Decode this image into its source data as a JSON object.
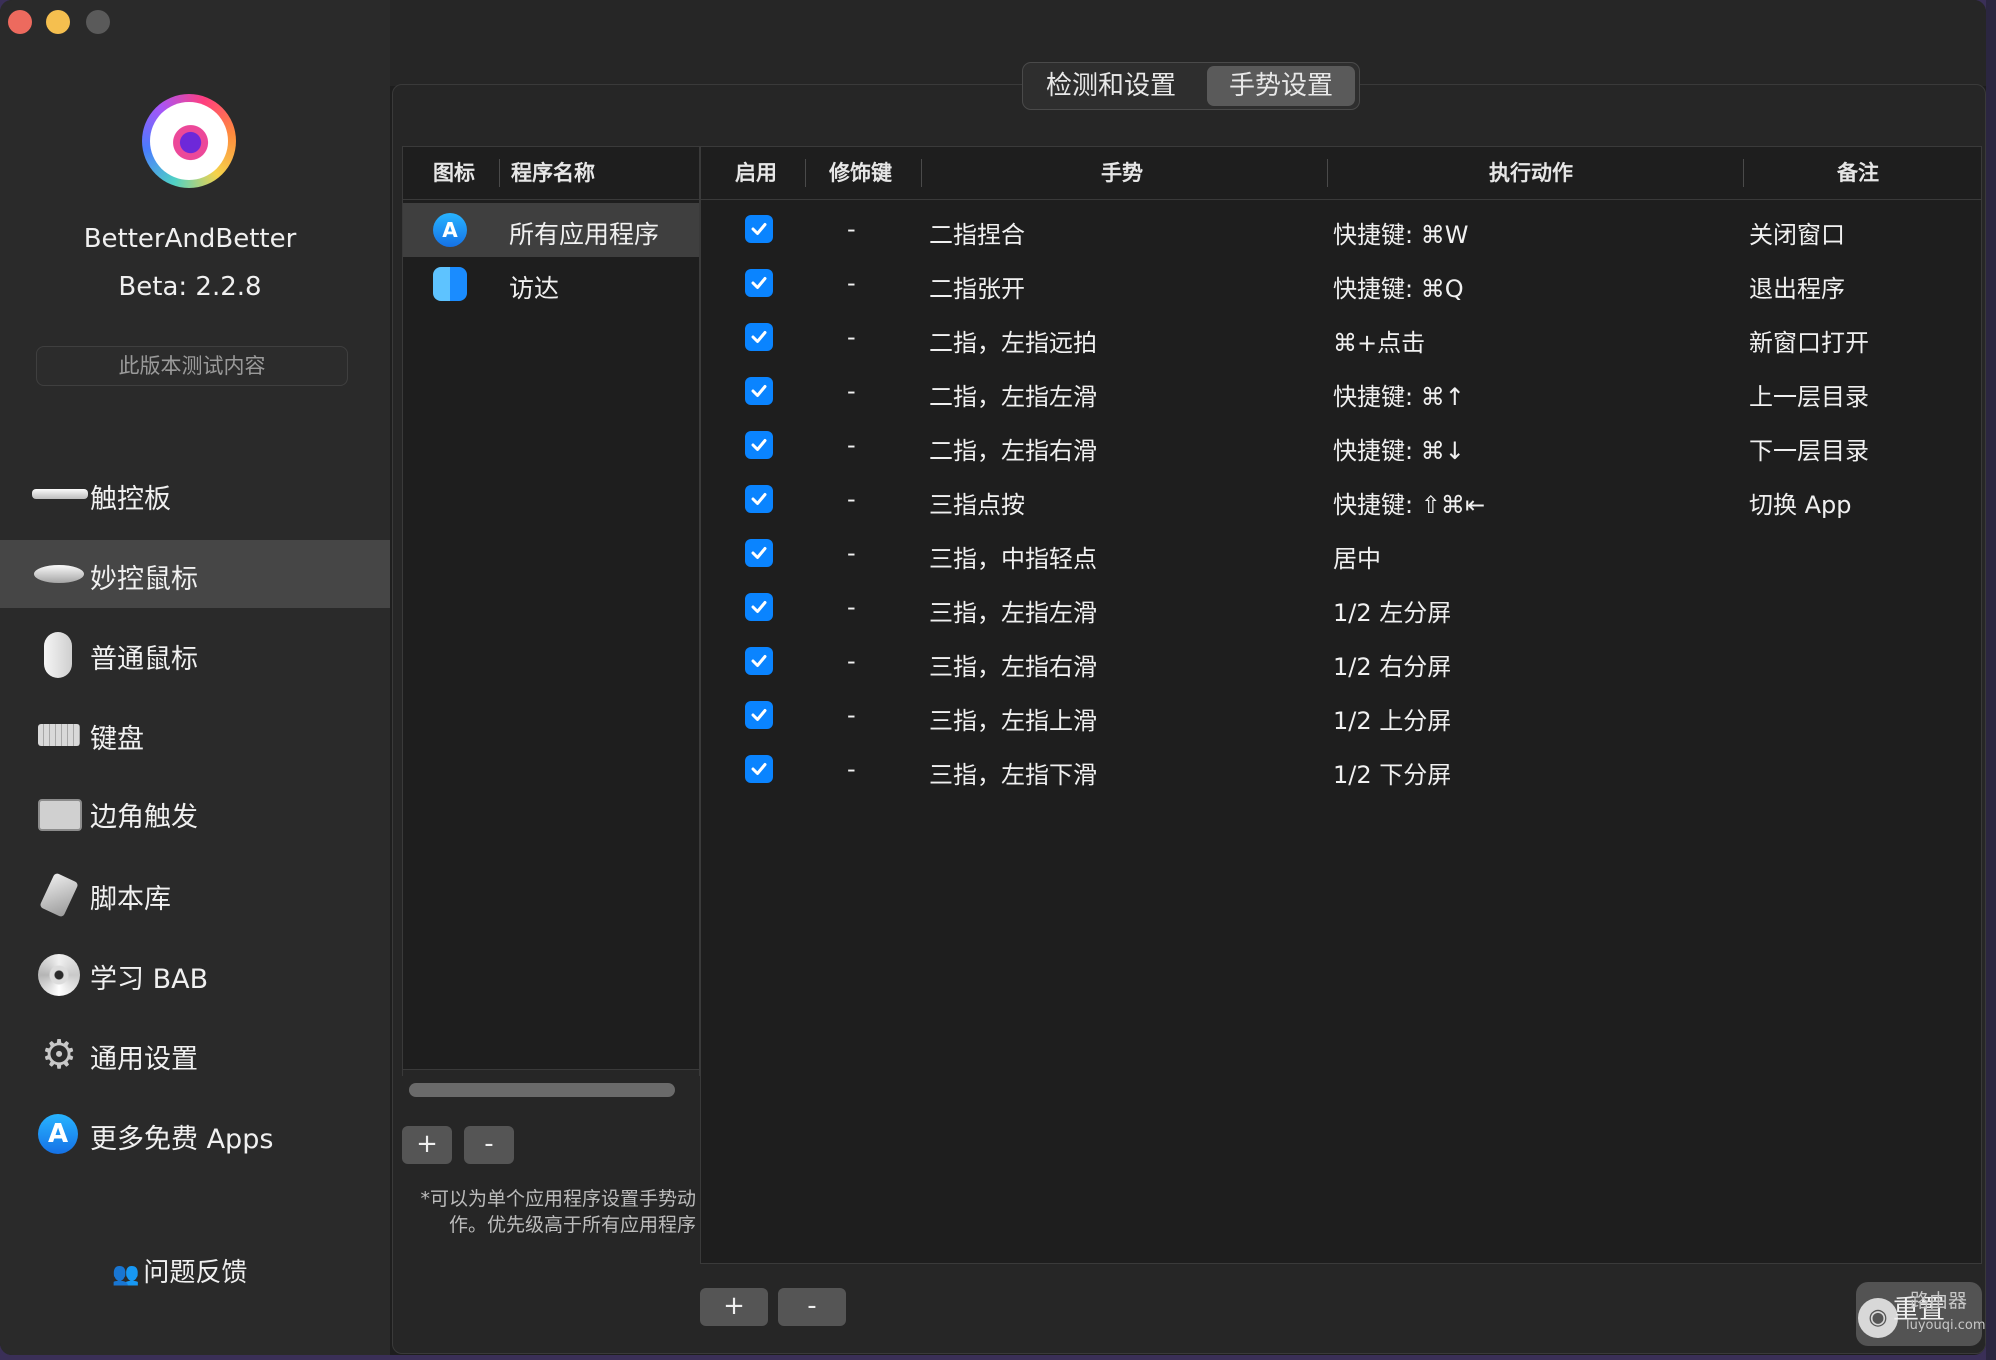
{
  "app": {
    "name": "BetterAndBetter",
    "version": "Beta: 2.2.8",
    "test_button": "此版本测试内容"
  },
  "sidebar": {
    "items": [
      {
        "label": "触控板",
        "icon": "trackpad-icon"
      },
      {
        "label": "妙控鼠标",
        "icon": "magic-mouse-icon",
        "active": true
      },
      {
        "label": "普通鼠标",
        "icon": "mouse-icon"
      },
      {
        "label": "键盘",
        "icon": "keyboard-icon"
      },
      {
        "label": "边角触发",
        "icon": "hot-corner-icon"
      },
      {
        "label": "脚本库",
        "icon": "script-icon"
      },
      {
        "label": "学习 BAB",
        "icon": "dvd-icon"
      },
      {
        "label": "通用设置",
        "icon": "gear-icon"
      },
      {
        "label": "更多免费 Apps",
        "icon": "app-store-icon"
      }
    ],
    "feedback": "问题反馈"
  },
  "tabs": [
    {
      "label": "检测和设置"
    },
    {
      "label": "手势设置",
      "selected": true
    }
  ],
  "app_table": {
    "headers": {
      "icon": "图标",
      "name": "程序名称"
    },
    "rows": [
      {
        "name": "所有应用程序",
        "icon": "app-store-icon",
        "selected": true
      },
      {
        "name": "访达",
        "icon": "finder-icon"
      }
    ],
    "add_label": "+",
    "remove_label": "-",
    "note": "*可以为单个应用程序设置手势动作。优先级高于所有应用程序"
  },
  "gesture_table": {
    "headers": {
      "enabled": "启用",
      "modifier": "修饰键",
      "gesture": "手势",
      "action": "执行动作",
      "note": "备注"
    },
    "rows": [
      {
        "enabled": true,
        "modifier": "-",
        "gesture": "二指捏合",
        "action": "快捷键: ⌘W",
        "note": "关闭窗口"
      },
      {
        "enabled": true,
        "modifier": "-",
        "gesture": "二指张开",
        "action": "快捷键: ⌘Q",
        "note": "退出程序"
      },
      {
        "enabled": true,
        "modifier": "-",
        "gesture": "二指，左指远拍",
        "action": "⌘+点击",
        "note": "新窗口打开"
      },
      {
        "enabled": true,
        "modifier": "-",
        "gesture": "二指，左指左滑",
        "action": "快捷键: ⌘↑",
        "note": "上一层目录"
      },
      {
        "enabled": true,
        "modifier": "-",
        "gesture": "二指，左指右滑",
        "action": "快捷键: ⌘↓",
        "note": "下一层目录"
      },
      {
        "enabled": true,
        "modifier": "-",
        "gesture": "三指点按",
        "action": "快捷键: ⇧⌘⇤",
        "note": "切换 App"
      },
      {
        "enabled": true,
        "modifier": "-",
        "gesture": "三指，中指轻点",
        "action": "居中",
        "note": ""
      },
      {
        "enabled": true,
        "modifier": "-",
        "gesture": "三指，左指左滑",
        "action": "1/2 左分屏",
        "note": ""
      },
      {
        "enabled": true,
        "modifier": "-",
        "gesture": "三指，左指右滑",
        "action": "1/2 右分屏",
        "note": ""
      },
      {
        "enabled": true,
        "modifier": "-",
        "gesture": "三指，左指上滑",
        "action": "1/2 上分屏",
        "note": ""
      },
      {
        "enabled": true,
        "modifier": "-",
        "gesture": "三指，左指下滑",
        "action": "1/2 下分屏",
        "note": ""
      }
    ],
    "add_label": "+",
    "remove_label": "-",
    "reset_label": "重置"
  },
  "watermark": {
    "brand": "路由器",
    "url": "luyouqi.com"
  },
  "colors": {
    "accent": "#0a84ff",
    "sidebar_bg": "#2a2a2a",
    "selection": "#464646"
  }
}
